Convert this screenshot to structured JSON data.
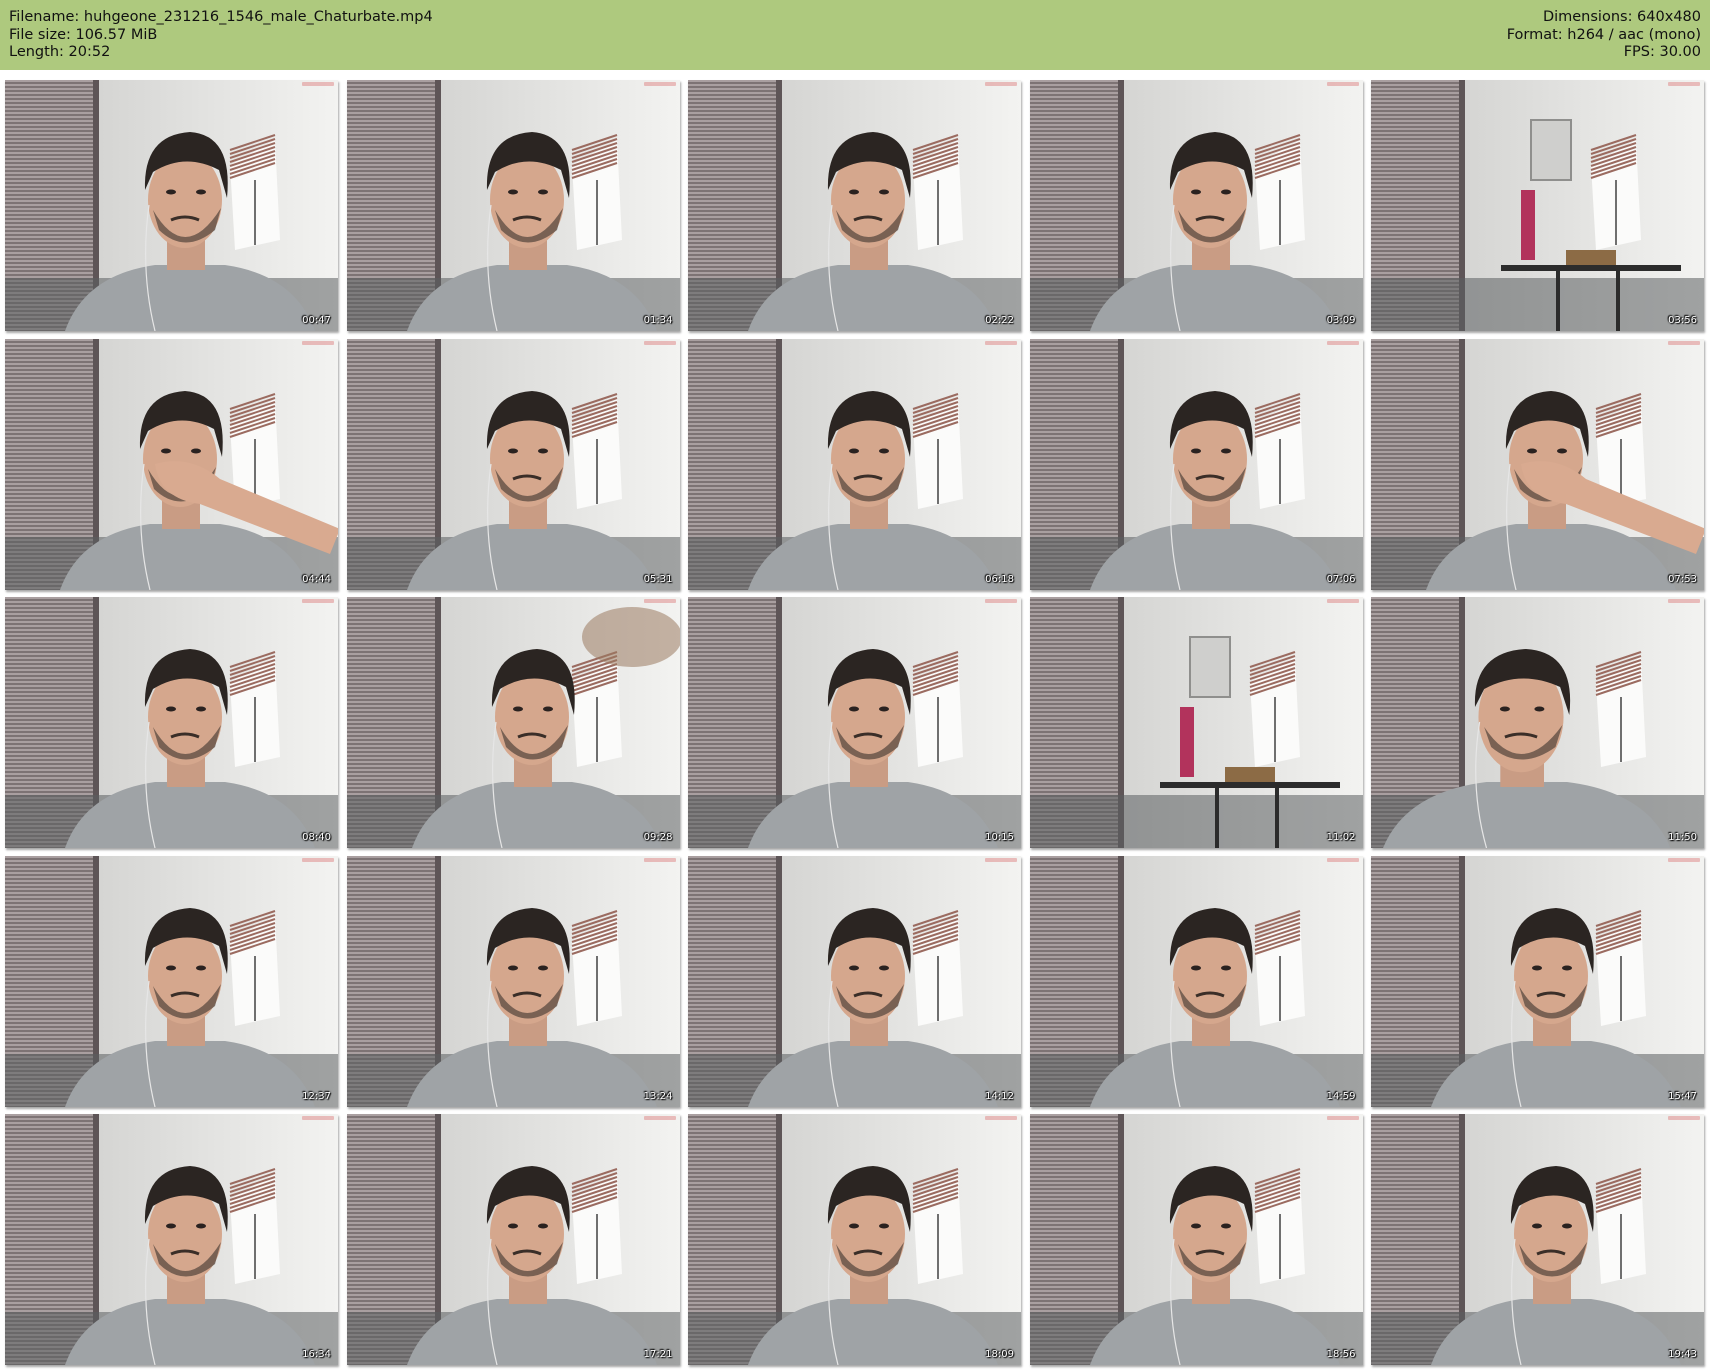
{
  "header": {
    "filename": "Filename: huhgeone_231216_1546_male_Chaturbate.mp4",
    "filesize": "File size: 106.57 MiB",
    "length": "Length: 20:52",
    "dimensions": "Dimensions: 640x480",
    "format": "Format: h264 / aac (mono)",
    "fps": "FPS: 30.00"
  },
  "colors": {
    "header_bg": "#aec97e",
    "wall": "#e4e4e2",
    "blinds": "#8a7f80",
    "shirt": "#9fa3a6",
    "hair": "#2b2522"
  },
  "thumbnails": [
    {
      "time": "00:47",
      "scene": "face"
    },
    {
      "time": "01:34",
      "scene": "face"
    },
    {
      "time": "02:22",
      "scene": "face"
    },
    {
      "time": "03:09",
      "scene": "face"
    },
    {
      "time": "03:56",
      "scene": "empty-room"
    },
    {
      "time": "04:44",
      "scene": "face-hand"
    },
    {
      "time": "05:31",
      "scene": "face"
    },
    {
      "time": "06:18",
      "scene": "face"
    },
    {
      "time": "07:06",
      "scene": "face"
    },
    {
      "time": "07:53",
      "scene": "face-hand"
    },
    {
      "time": "08:40",
      "scene": "face"
    },
    {
      "time": "09:28",
      "scene": "face-blur"
    },
    {
      "time": "10:15",
      "scene": "face"
    },
    {
      "time": "11:02",
      "scene": "empty-room"
    },
    {
      "time": "11:50",
      "scene": "face-close"
    },
    {
      "time": "12:37",
      "scene": "face"
    },
    {
      "time": "13:24",
      "scene": "face"
    },
    {
      "time": "14:12",
      "scene": "face"
    },
    {
      "time": "14:59",
      "scene": "face"
    },
    {
      "time": "15:47",
      "scene": "face"
    },
    {
      "time": "16:34",
      "scene": "face"
    },
    {
      "time": "17:21",
      "scene": "face"
    },
    {
      "time": "18:09",
      "scene": "face"
    },
    {
      "time": "18:56",
      "scene": "face"
    },
    {
      "time": "19:43",
      "scene": "face"
    }
  ]
}
